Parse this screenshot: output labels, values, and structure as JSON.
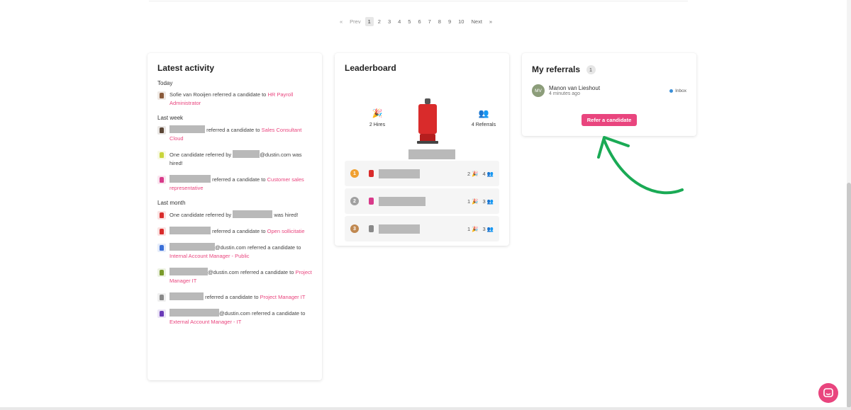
{
  "pagination": {
    "first": "«",
    "prev": "Prev",
    "pages": [
      "1",
      "2",
      "3",
      "4",
      "5",
      "6",
      "7",
      "8",
      "9",
      "10"
    ],
    "active": "1",
    "next": "Next",
    "last": "»"
  },
  "activity": {
    "title": "Latest activity",
    "groups": [
      {
        "label": "Today",
        "items": [
          {
            "avatar_color": "#8a5a3a",
            "redacted": false,
            "actor": "Sofie van Rooijen",
            "text": " referred a candidate to ",
            "link": "HR Payroll Administrator"
          }
        ]
      },
      {
        "label": "Last week",
        "items": [
          {
            "avatar_color": "#5b4636",
            "redacted": true,
            "actor": "",
            "text": " referred a candidate to ",
            "link": "Sales Consultant Cloud"
          },
          {
            "avatar_color": "#c9d53a",
            "redacted": true,
            "prefix": "One candidate referred by ",
            "actor": "",
            "suffix_text": "@dustin.com was hired!",
            "text": "",
            "link": ""
          },
          {
            "avatar_color": "#d83a8a",
            "redacted": true,
            "actor": "",
            "text": " referred a candidate to ",
            "link": "Customer sales representative"
          }
        ]
      },
      {
        "label": "Last month",
        "items": [
          {
            "avatar_color": "#d92b2b",
            "redacted": true,
            "prefix": "One candidate referred by ",
            "actor": "",
            "suffix_text": " was hired!",
            "text": "",
            "link": ""
          },
          {
            "avatar_color": "#d92b2b",
            "redacted": true,
            "actor": "",
            "text": " referred a candidate to ",
            "link": "Open sollicitatie"
          },
          {
            "avatar_color": "#3a6fd8",
            "redacted": true,
            "actor": "",
            "text": "@dustin.com referred a candidate to ",
            "link": "Internal Account Manager - Public"
          },
          {
            "avatar_color": "#7a9a2a",
            "redacted": true,
            "actor": "",
            "text": "@dustin.com referred a candidate to ",
            "link": "Project Manager IT"
          },
          {
            "avatar_color": "#8a8a8a",
            "redacted": true,
            "actor": "",
            "text": " referred a candidate to ",
            "link": "Project Manager IT"
          },
          {
            "avatar_color": "#6a3ab8",
            "redacted": true,
            "actor": "",
            "text": "@dustin.com referred a candidate to ",
            "link": "External Account Manager - IT"
          }
        ]
      }
    ]
  },
  "leaderboard": {
    "title": "Leaderboard",
    "hires_label": "2 Hires",
    "referrals_label": "4 Referrals",
    "rows": [
      {
        "rank": "1",
        "rank_color": "#f0a030",
        "avatar_color": "#d92b2b",
        "hires": "2",
        "referrals": "4"
      },
      {
        "rank": "2",
        "rank_color": "#a0a0a0",
        "avatar_color": "#d83a8a",
        "hires": "1",
        "referrals": "3"
      },
      {
        "rank": "3",
        "rank_color": "#c08850",
        "avatar_color": "#8a8a8a",
        "hires": "1",
        "referrals": "3"
      }
    ]
  },
  "referrals": {
    "title": "My referrals",
    "count": "1",
    "item": {
      "initials": "MV",
      "name": "Manon van Lieshout",
      "time": "4 minutes ago",
      "status": "Inbox"
    },
    "button_label": "Refer a candidate"
  },
  "colors": {
    "accent": "#e9457e",
    "arrow": "#1aaa55",
    "status_dot": "#3a8fd8"
  }
}
